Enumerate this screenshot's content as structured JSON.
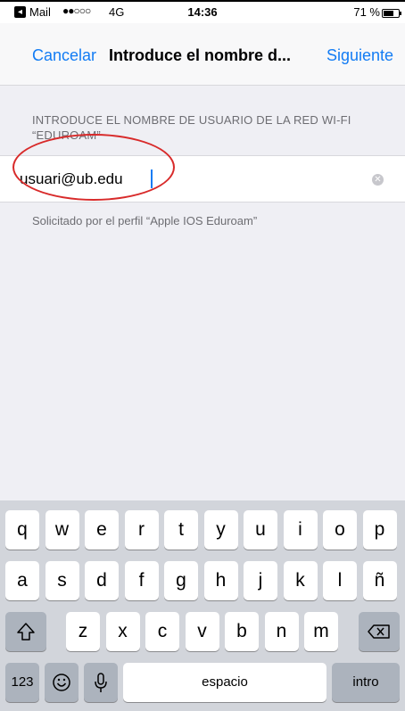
{
  "status_bar": {
    "back_app": "Mail",
    "signal": "●●○○○",
    "network": "4G",
    "time": "14:36",
    "battery_percent": "71 %",
    "battery_level": 0.71
  },
  "nav": {
    "cancel_label": "Cancelar",
    "title": "Introduce el nombre d...",
    "next_label": "Siguiente"
  },
  "form": {
    "section_header": "INTRODUCE EL NOMBRE DE USUARIO DE LA RED WI-FI “EDUROAM”",
    "username_value": "usuari@ub.edu",
    "footer_note": "Solicitado por el perfil “Apple IOS Eduroam”"
  },
  "keyboard": {
    "row1": [
      "q",
      "w",
      "e",
      "r",
      "t",
      "y",
      "u",
      "i",
      "o",
      "p"
    ],
    "row2": [
      "a",
      "s",
      "d",
      "f",
      "g",
      "h",
      "j",
      "k",
      "l",
      "ñ"
    ],
    "row3": [
      "z",
      "x",
      "c",
      "v",
      "b",
      "n",
      "m"
    ],
    "numbers_label": "123",
    "space_label": "espacio",
    "return_label": "intro",
    "icons": [
      "shift-icon",
      "backspace-icon",
      "emoji-icon",
      "microphone-icon"
    ]
  },
  "colors": {
    "accent": "#137cf4",
    "annotation": "#d82a2a",
    "keyboard_bg": "#d2d5db"
  }
}
